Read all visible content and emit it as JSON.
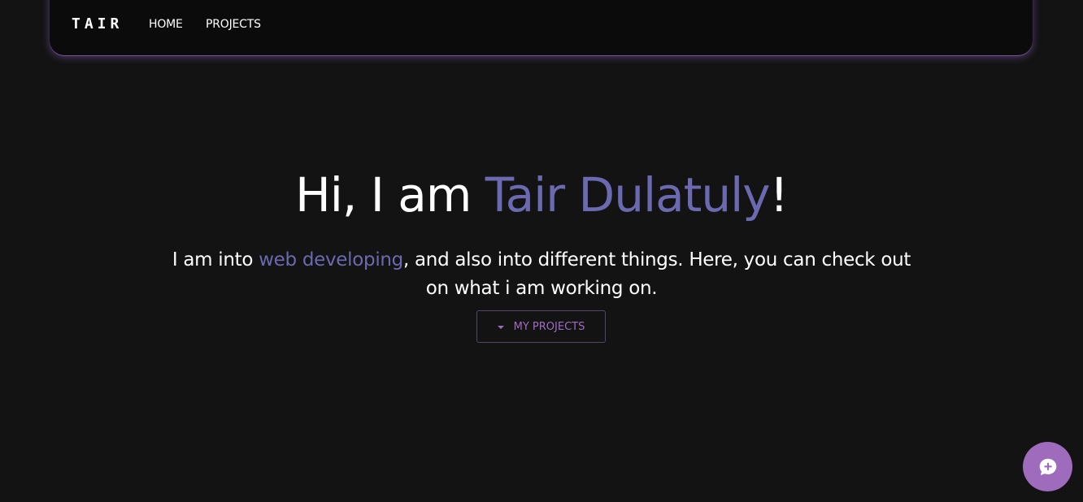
{
  "nav": {
    "brand": "TAIR",
    "links": [
      {
        "label": "HOME"
      },
      {
        "label": "PROJECTS"
      }
    ]
  },
  "hero": {
    "title_prefix": "Hi, I am ",
    "title_name": "Tair Dulatuly",
    "title_suffix": "!",
    "subtitle_prefix": "I am into ",
    "subtitle_highlight": "web developing",
    "subtitle_suffix": ", and also into different things. Here, you can check out on what i am working on.",
    "cta_label": "MY PROJECTS",
    "cta_icon": "caret-down-icon"
  },
  "chat": {
    "icon": "chat-plus-icon"
  },
  "colors": {
    "background": "#131313",
    "navbar": "#0b0b0b",
    "accent_name": "#6b6ab0",
    "accent_button": "#a06cc0",
    "chat_button": "#9e6bbd"
  }
}
